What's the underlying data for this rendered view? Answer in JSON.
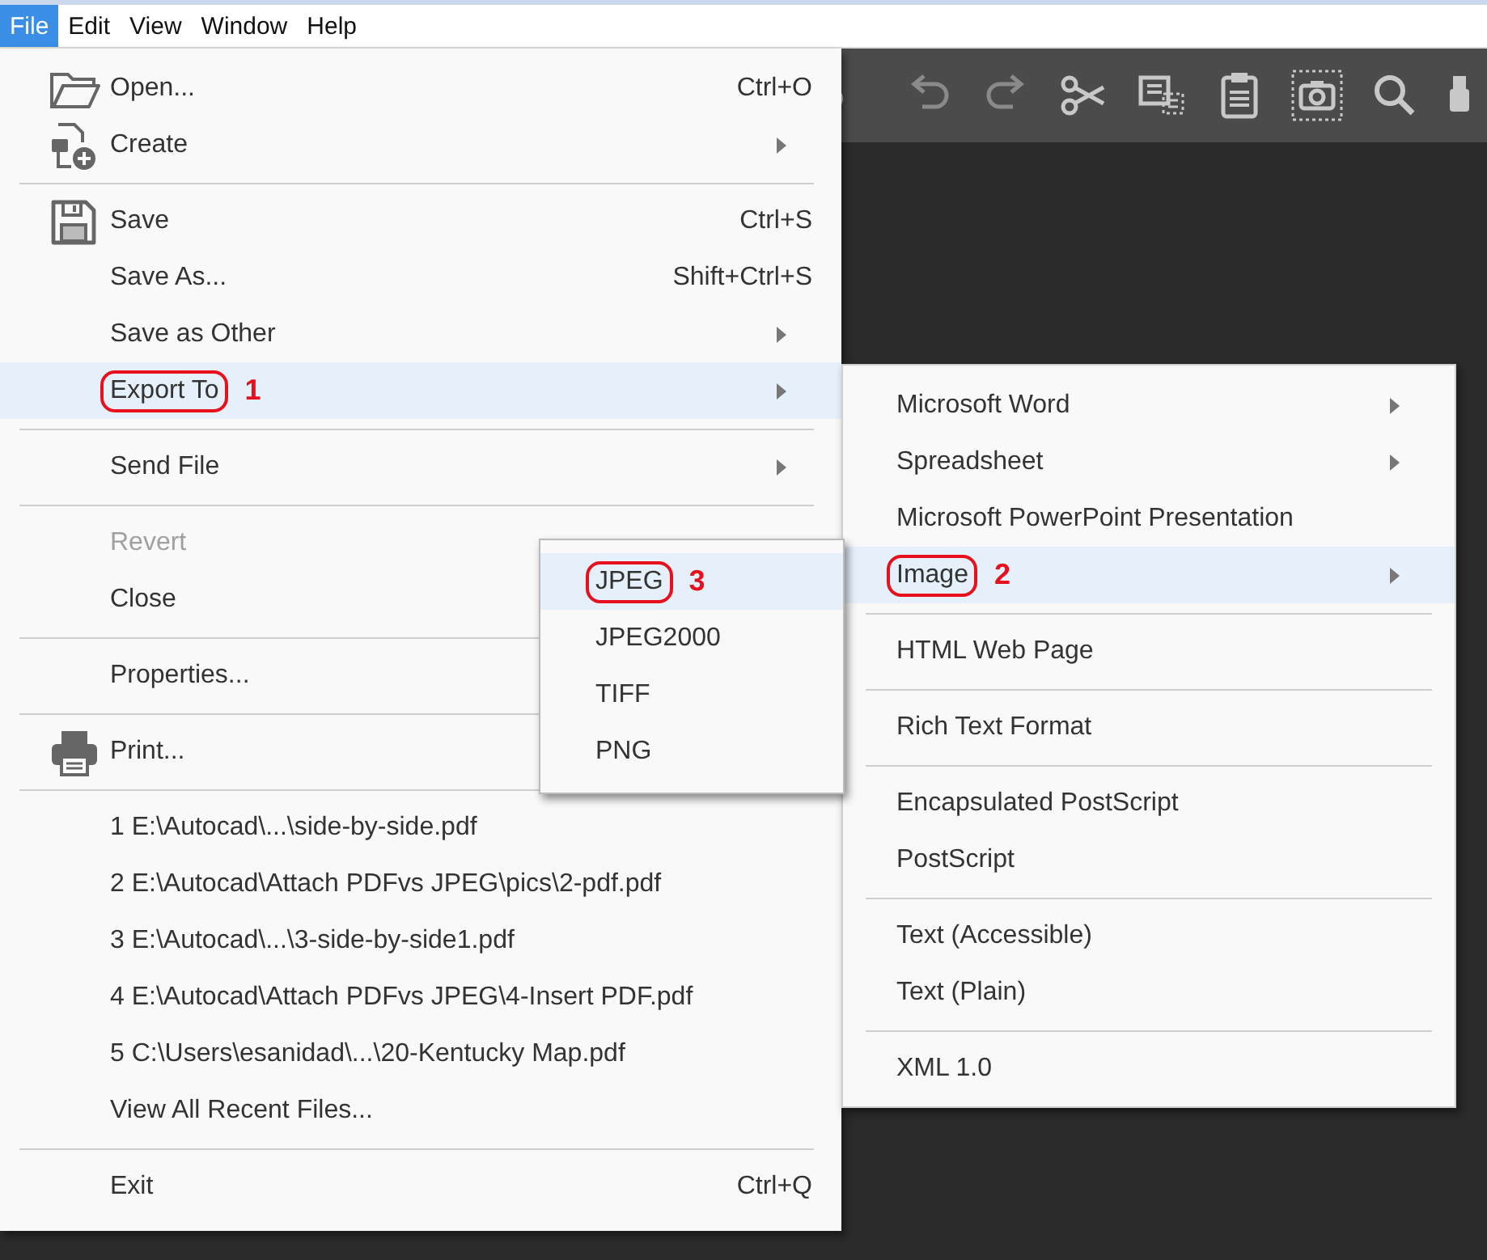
{
  "menu_bar": [
    {
      "label": "File",
      "selected": true
    },
    {
      "label": "Edit",
      "selected": false
    },
    {
      "label": "View",
      "selected": false
    },
    {
      "label": "Window",
      "selected": false
    },
    {
      "label": "Help",
      "selected": false
    }
  ],
  "file_menu": {
    "items": [
      {
        "kind": "item",
        "label": "Open...",
        "shortcut": "Ctrl+O",
        "submenu": false,
        "disabled": false,
        "selected": false
      },
      {
        "kind": "item",
        "label": "Create",
        "submenu": true,
        "disabled": false,
        "selected": false
      },
      {
        "kind": "separator"
      },
      {
        "kind": "item",
        "label": "Save",
        "shortcut": "Ctrl+S",
        "submenu": false,
        "disabled": false,
        "selected": false
      },
      {
        "kind": "item",
        "label": "Save As...",
        "shortcut": "Shift+Ctrl+S",
        "submenu": false,
        "disabled": false,
        "selected": false
      },
      {
        "kind": "item",
        "label": "Save as Other",
        "submenu": true,
        "disabled": false,
        "selected": false
      },
      {
        "kind": "item",
        "label": "Export To",
        "callout": "1",
        "submenu": true,
        "disabled": false,
        "selected": true
      },
      {
        "kind": "separator"
      },
      {
        "kind": "item",
        "label": "Send File",
        "submenu": true,
        "disabled": false,
        "selected": false
      },
      {
        "kind": "separator"
      },
      {
        "kind": "item",
        "label": "Revert",
        "submenu": false,
        "disabled": true,
        "selected": false
      },
      {
        "kind": "item",
        "label": "Close",
        "submenu": false,
        "disabled": false,
        "selected": false
      },
      {
        "kind": "separator"
      },
      {
        "kind": "item",
        "label": "Properties...",
        "submenu": false,
        "disabled": false,
        "selected": false
      },
      {
        "kind": "separator"
      },
      {
        "kind": "item",
        "label": "Print...",
        "submenu": false,
        "disabled": false,
        "selected": false
      },
      {
        "kind": "separator"
      },
      {
        "kind": "item",
        "label": "1 E:\\Autocad\\...\\side-by-side.pdf",
        "submenu": false,
        "disabled": false,
        "selected": false
      },
      {
        "kind": "item",
        "label": "2 E:\\Autocad\\Attach PDFvs JPEG\\pics\\2-pdf.pdf",
        "submenu": false,
        "disabled": false,
        "selected": false
      },
      {
        "kind": "item",
        "label": "3 E:\\Autocad\\...\\3-side-by-side1.pdf",
        "submenu": false,
        "disabled": false,
        "selected": false
      },
      {
        "kind": "item",
        "label": "4 E:\\Autocad\\Attach PDFvs JPEG\\4-Insert PDF.pdf",
        "submenu": false,
        "disabled": false,
        "selected": false
      },
      {
        "kind": "item",
        "label": "5 C:\\Users\\esanidad\\...\\20-Kentucky Map.pdf",
        "submenu": false,
        "disabled": false,
        "selected": false
      },
      {
        "kind": "item",
        "label": "View All Recent Files...",
        "submenu": false,
        "disabled": false,
        "selected": false
      },
      {
        "kind": "separator"
      },
      {
        "kind": "item",
        "label": "Exit",
        "shortcut": "Ctrl+Q",
        "submenu": false,
        "disabled": false,
        "selected": false
      }
    ]
  },
  "export_menu": {
    "items": [
      {
        "kind": "item",
        "label": "Microsoft Word",
        "submenu": true,
        "disabled": false,
        "selected": false
      },
      {
        "kind": "item",
        "label": "Spreadsheet",
        "submenu": true,
        "disabled": false,
        "selected": false
      },
      {
        "kind": "item",
        "label": "Microsoft PowerPoint Presentation",
        "submenu": false,
        "disabled": false,
        "selected": false
      },
      {
        "kind": "item",
        "label": "Image",
        "callout": "2",
        "submenu": true,
        "disabled": false,
        "selected": true
      },
      {
        "kind": "separator"
      },
      {
        "kind": "item",
        "label": "HTML Web Page",
        "submenu": false,
        "disabled": false,
        "selected": false
      },
      {
        "kind": "separator"
      },
      {
        "kind": "item",
        "label": "Rich Text Format",
        "submenu": false,
        "disabled": false,
        "selected": false
      },
      {
        "kind": "separator"
      },
      {
        "kind": "item",
        "label": "Encapsulated PostScript",
        "submenu": false,
        "disabled": false,
        "selected": false
      },
      {
        "kind": "item",
        "label": "PostScript",
        "submenu": false,
        "disabled": false,
        "selected": false
      },
      {
        "kind": "separator"
      },
      {
        "kind": "item",
        "label": "Text (Accessible)",
        "submenu": false,
        "disabled": false,
        "selected": false
      },
      {
        "kind": "item",
        "label": "Text (Plain)",
        "submenu": false,
        "disabled": false,
        "selected": false
      },
      {
        "kind": "separator"
      },
      {
        "kind": "item",
        "label": "XML 1.0",
        "submenu": false,
        "disabled": false,
        "selected": false
      }
    ]
  },
  "image_menu": {
    "items": [
      {
        "kind": "item",
        "label": "JPEG",
        "callout": "3",
        "submenu": false,
        "disabled": false,
        "selected": true
      },
      {
        "kind": "item",
        "label": "JPEG2000",
        "submenu": false,
        "disabled": false,
        "selected": false
      },
      {
        "kind": "item",
        "label": "TIFF",
        "submenu": false,
        "disabled": false,
        "selected": false
      },
      {
        "kind": "item",
        "label": "PNG",
        "submenu": false,
        "disabled": false,
        "selected": false
      }
    ]
  }
}
